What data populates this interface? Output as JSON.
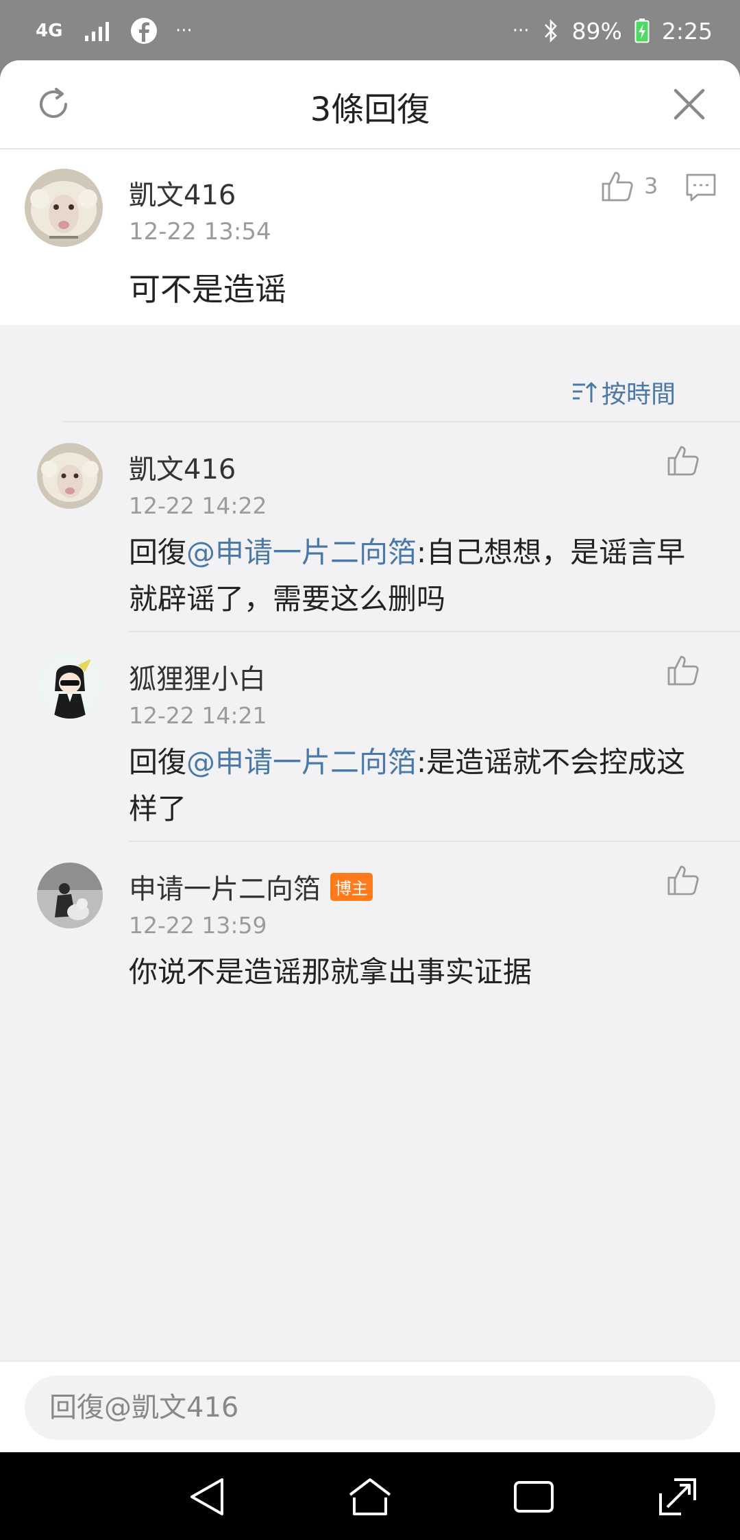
{
  "status_bar": {
    "network": "4G",
    "more_left": "···",
    "more_right": "···",
    "battery": "89%",
    "time": "2:25",
    "icons": [
      "signal-icon",
      "facebook-icon",
      "bluetooth-icon",
      "battery-charging-icon"
    ]
  },
  "header": {
    "title": "3條回復",
    "icons": [
      "refresh-icon",
      "close-icon"
    ]
  },
  "main_comment": {
    "name": "凱文416",
    "time": "12-22 13:54",
    "text": "可不是造谣",
    "like_count": "3",
    "icons": [
      "thumbs-up-icon",
      "comment-icon"
    ]
  },
  "sort": {
    "label": "按時間",
    "icon": "sort-icon"
  },
  "replies": [
    {
      "name": "凱文416",
      "time": "12-22 14:22",
      "prefix": "回復",
      "mention": "@申请一片二向箔",
      "text": ":自己想想，是谣言早就辟谣了，需要这么删吗"
    },
    {
      "name": "狐狸狸小白",
      "time": "12-22 14:21",
      "prefix": "回復",
      "mention": "@申请一片二向箔",
      "text": ":是造谣就不会控成这样了"
    },
    {
      "name": "申请一片二向箔",
      "badge": "博主",
      "time": "12-22 13:59",
      "text": "你说不是造谣那就拿出事实证据"
    }
  ],
  "input": {
    "placeholder": "回復@凱文416"
  },
  "colors": {
    "accent": "#4a78a8",
    "badge": "#ff7a1a",
    "background": "#f2f2f5",
    "status_bar": "#888888"
  },
  "nav_bar": {
    "icons": [
      "back-icon",
      "home-icon",
      "recents-icon",
      "screenshot-icon"
    ]
  }
}
